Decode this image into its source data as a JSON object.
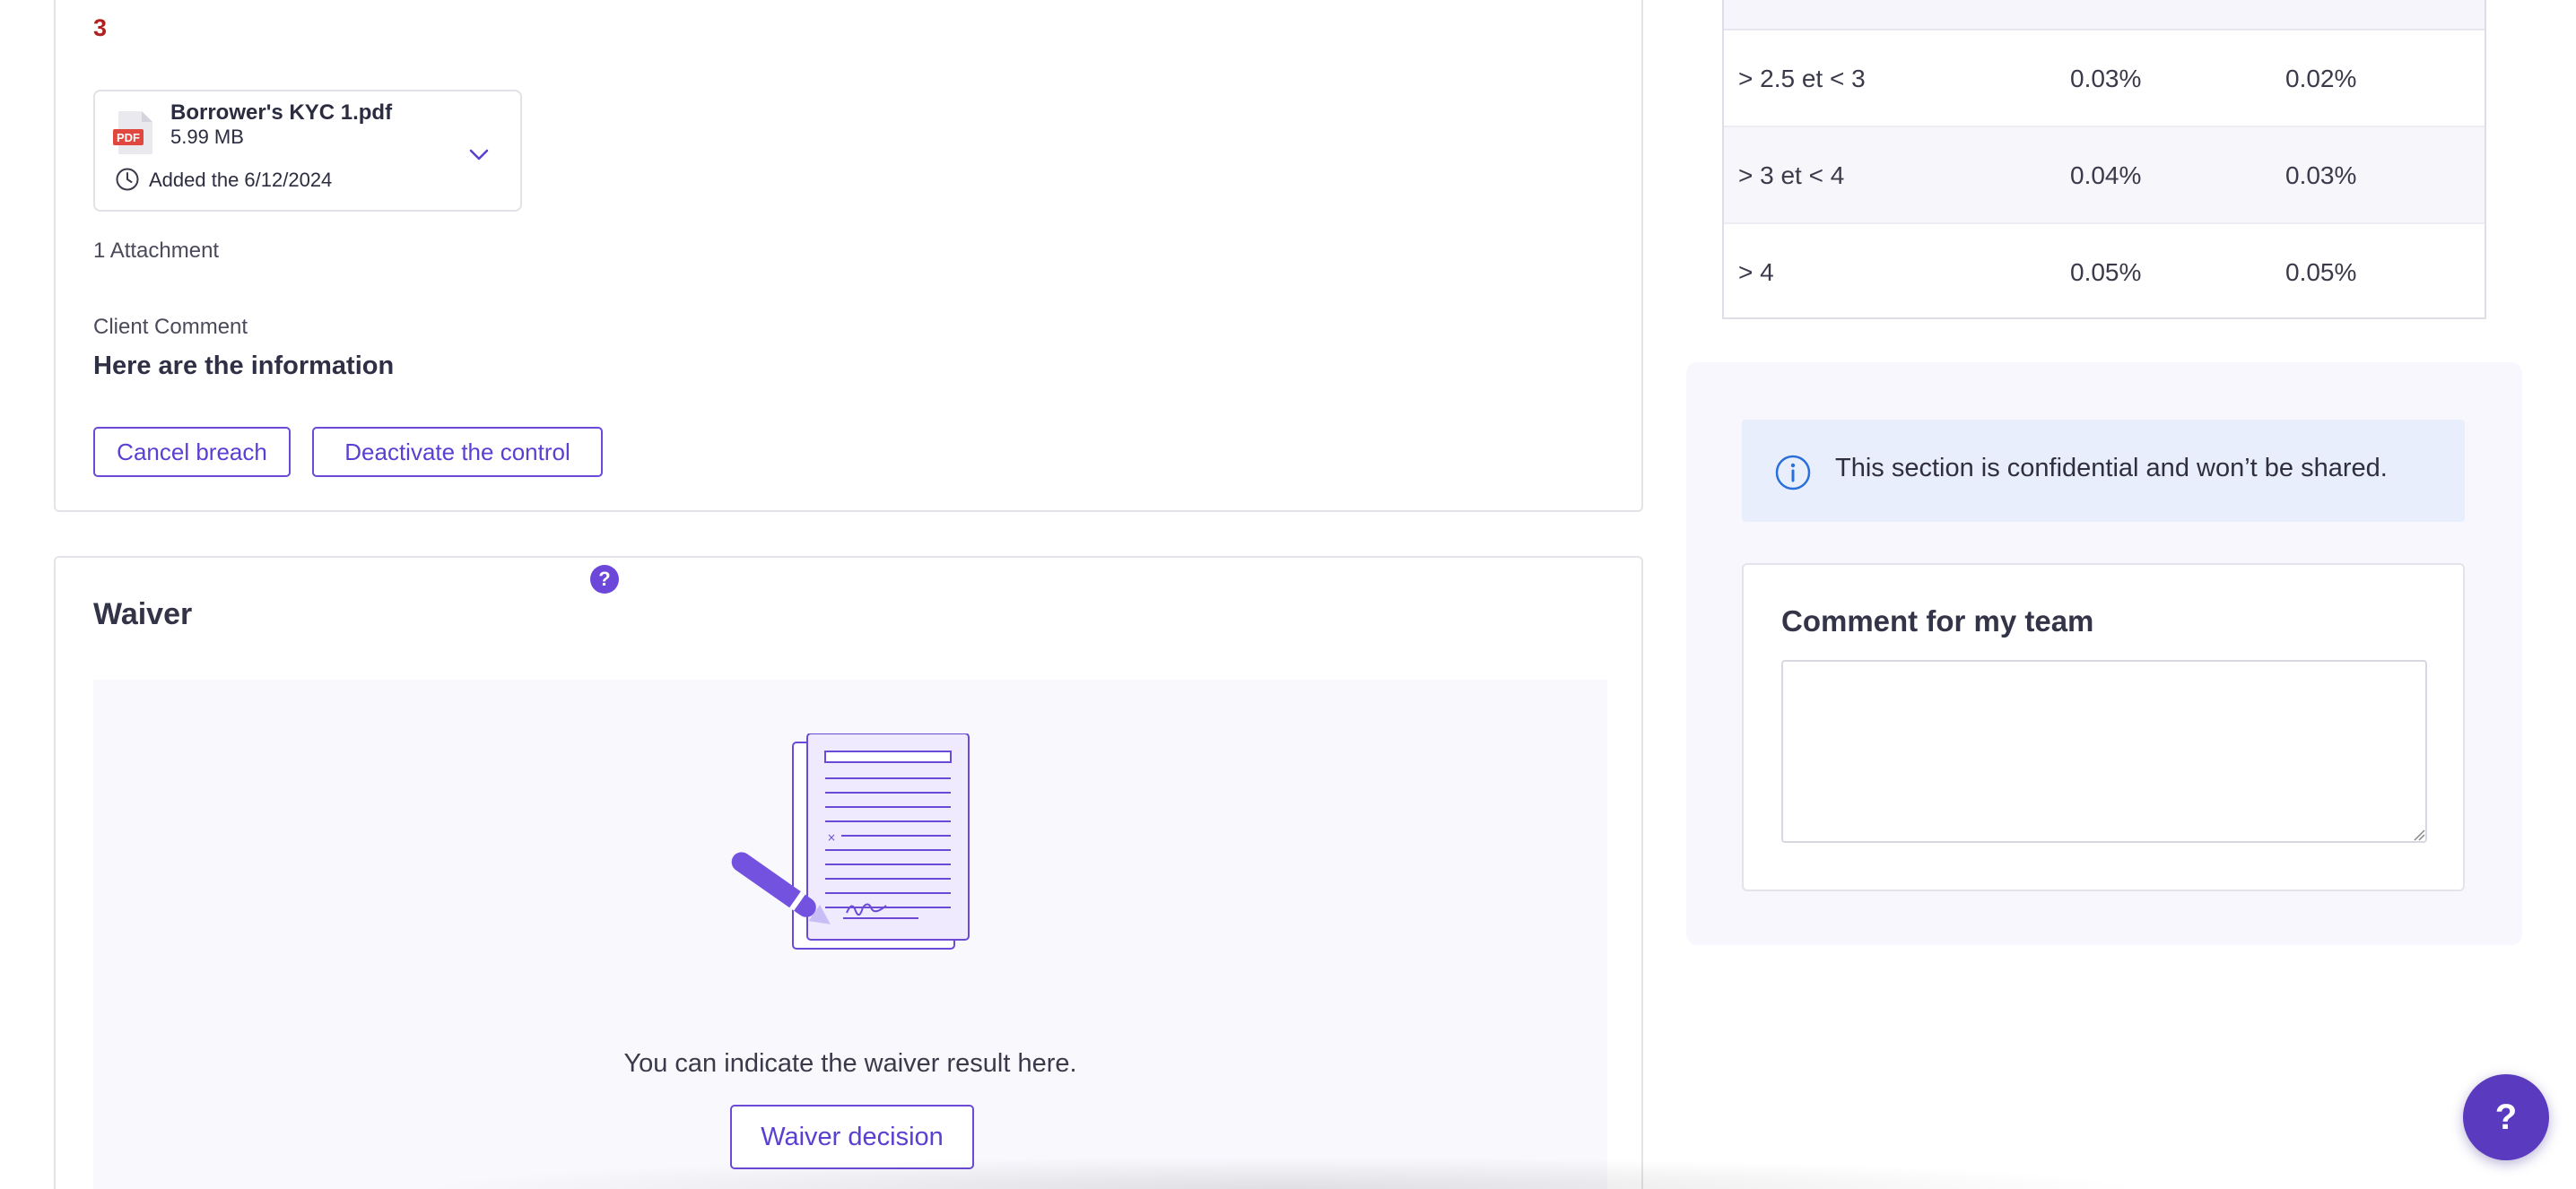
{
  "breach": {
    "count": "3",
    "file": {
      "name": "Borrower's KYC 1.pdf",
      "size": "5.99 MB",
      "added": "Added the 6/12/2024",
      "icon": "pdf-file-icon"
    },
    "attachments_label": "1 Attachment",
    "client_comment_label": "Client Comment",
    "client_comment_text": "Here are the information",
    "cancel_button": "Cancel breach",
    "deactivate_button": "Deactivate the control"
  },
  "waiver": {
    "help_icon_text": "?",
    "title": "Waiver",
    "info_text": "You can indicate the waiver result here.",
    "decision_button": "Waiver decision"
  },
  "rates": {
    "rows": [
      {
        "range": "> 2.5 et < 3",
        "a": "0.03%",
        "b": "0.02%"
      },
      {
        "range": "> 3 et < 4",
        "a": "0.04%",
        "b": "0.03%"
      },
      {
        "range": "> 4",
        "a": "0.05%",
        "b": "0.05%"
      }
    ]
  },
  "confidential": {
    "banner_text": "This section is confidential and won’t be shared.",
    "team_comment_title": "Comment for my team",
    "team_comment_value": ""
  },
  "fab": {
    "label": "?"
  },
  "colors": {
    "accent": "#5b3ed2",
    "danger": "#b21f1f",
    "info_bg": "#e8eefb",
    "panel_bg": "#f8f7fd"
  }
}
